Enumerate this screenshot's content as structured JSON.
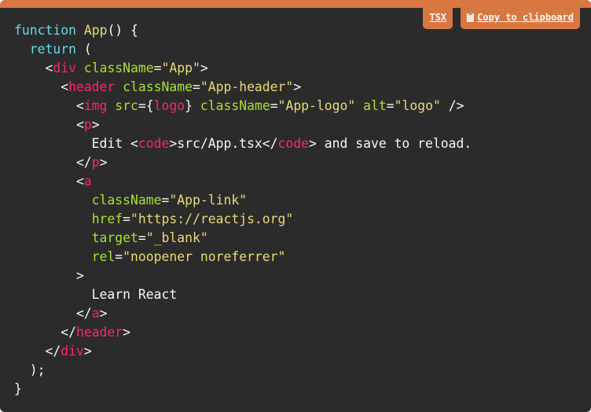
{
  "toolbar": {
    "language_label": "TSX",
    "copy_label": "Copy to clipboard",
    "copy_icon": "clipboard-icon"
  },
  "colors": {
    "accent": "#d97742",
    "background": "#2b2b2b",
    "keyword": "#66d9ef",
    "function": "#e6db74",
    "tag": "#f92672",
    "attribute": "#a6e22e",
    "string": "#e6db74",
    "text": "#f8f8f2"
  },
  "code_lines": [
    [
      {
        "c": "kw",
        "t": "function"
      },
      {
        "c": "pl",
        "t": " "
      },
      {
        "c": "fn",
        "t": "App"
      },
      {
        "c": "pl",
        "t": "() {"
      }
    ],
    [
      {
        "c": "pl",
        "t": "  "
      },
      {
        "c": "kw",
        "t": "return"
      },
      {
        "c": "pl",
        "t": " ("
      }
    ],
    [
      {
        "c": "pl",
        "t": "    <"
      },
      {
        "c": "tg",
        "t": "div"
      },
      {
        "c": "pl",
        "t": " "
      },
      {
        "c": "at",
        "t": "className"
      },
      {
        "c": "pl",
        "t": "="
      },
      {
        "c": "st",
        "t": "\"App\""
      },
      {
        "c": "pl",
        "t": ">"
      }
    ],
    [
      {
        "c": "pl",
        "t": "      <"
      },
      {
        "c": "tg",
        "t": "header"
      },
      {
        "c": "pl",
        "t": " "
      },
      {
        "c": "at",
        "t": "className"
      },
      {
        "c": "pl",
        "t": "="
      },
      {
        "c": "st",
        "t": "\"App-header\""
      },
      {
        "c": "pl",
        "t": ">"
      }
    ],
    [
      {
        "c": "pl",
        "t": "        <"
      },
      {
        "c": "tg",
        "t": "img"
      },
      {
        "c": "pl",
        "t": " "
      },
      {
        "c": "at",
        "t": "src"
      },
      {
        "c": "pl",
        "t": "={"
      },
      {
        "c": "tg",
        "t": "logo"
      },
      {
        "c": "pl",
        "t": "} "
      },
      {
        "c": "at",
        "t": "className"
      },
      {
        "c": "pl",
        "t": "="
      },
      {
        "c": "st",
        "t": "\"App-logo\""
      },
      {
        "c": "pl",
        "t": " "
      },
      {
        "c": "at",
        "t": "alt"
      },
      {
        "c": "pl",
        "t": "="
      },
      {
        "c": "st",
        "t": "\"logo\""
      },
      {
        "c": "pl",
        "t": " />"
      }
    ],
    [
      {
        "c": "pl",
        "t": "        <"
      },
      {
        "c": "tg",
        "t": "p"
      },
      {
        "c": "pl",
        "t": ">"
      }
    ],
    [
      {
        "c": "pl",
        "t": "          Edit <"
      },
      {
        "c": "tg",
        "t": "code"
      },
      {
        "c": "pl",
        "t": ">src/App.tsx</"
      },
      {
        "c": "tg",
        "t": "code"
      },
      {
        "c": "pl",
        "t": "> and save to reload."
      }
    ],
    [
      {
        "c": "pl",
        "t": "        </"
      },
      {
        "c": "tg",
        "t": "p"
      },
      {
        "c": "pl",
        "t": ">"
      }
    ],
    [
      {
        "c": "pl",
        "t": "        <"
      },
      {
        "c": "tg",
        "t": "a"
      }
    ],
    [
      {
        "c": "pl",
        "t": "          "
      },
      {
        "c": "at",
        "t": "className"
      },
      {
        "c": "pl",
        "t": "="
      },
      {
        "c": "st",
        "t": "\"App-link\""
      }
    ],
    [
      {
        "c": "pl",
        "t": "          "
      },
      {
        "c": "at",
        "t": "href"
      },
      {
        "c": "pl",
        "t": "="
      },
      {
        "c": "st",
        "t": "\"https://reactjs.org\""
      }
    ],
    [
      {
        "c": "pl",
        "t": "          "
      },
      {
        "c": "at",
        "t": "target"
      },
      {
        "c": "pl",
        "t": "="
      },
      {
        "c": "st",
        "t": "\"_blank\""
      }
    ],
    [
      {
        "c": "pl",
        "t": "          "
      },
      {
        "c": "at",
        "t": "rel"
      },
      {
        "c": "pl",
        "t": "="
      },
      {
        "c": "st",
        "t": "\"noopener noreferrer\""
      }
    ],
    [
      {
        "c": "pl",
        "t": "        >"
      }
    ],
    [
      {
        "c": "pl",
        "t": "          Learn React"
      }
    ],
    [
      {
        "c": "pl",
        "t": "        </"
      },
      {
        "c": "tg",
        "t": "a"
      },
      {
        "c": "pl",
        "t": ">"
      }
    ],
    [
      {
        "c": "pl",
        "t": "      </"
      },
      {
        "c": "tg",
        "t": "header"
      },
      {
        "c": "pl",
        "t": ">"
      }
    ],
    [
      {
        "c": "pl",
        "t": "    </"
      },
      {
        "c": "tg",
        "t": "div"
      },
      {
        "c": "pl",
        "t": ">"
      }
    ],
    [
      {
        "c": "pl",
        "t": "  );"
      }
    ],
    [
      {
        "c": "pl",
        "t": "}"
      }
    ]
  ]
}
